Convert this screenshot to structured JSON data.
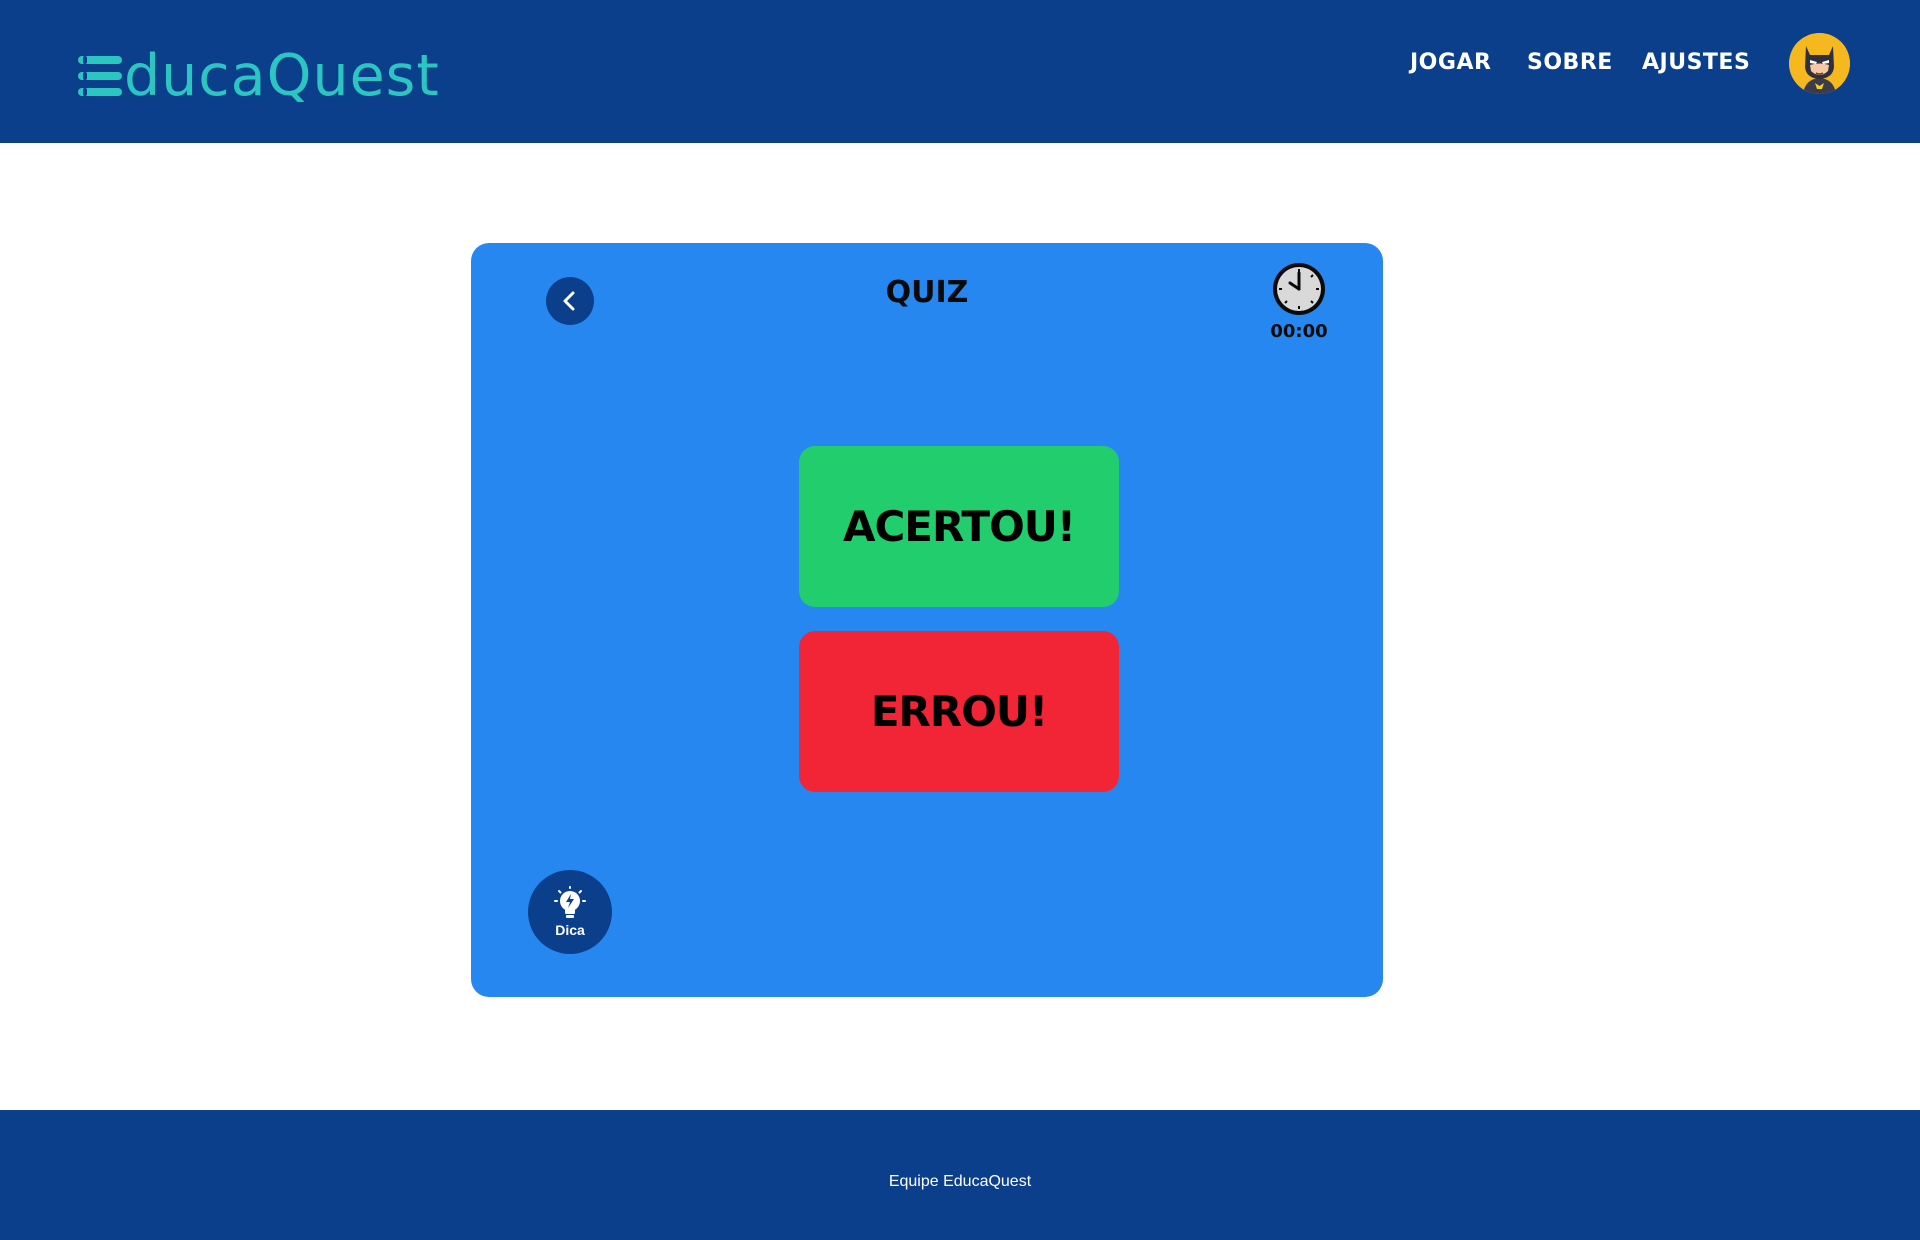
{
  "header": {
    "logo_text": "ducaQuest",
    "logo_icon": "hamburger-e-icon",
    "nav": [
      {
        "label": "JOGAR"
      },
      {
        "label": "SOBRE"
      },
      {
        "label": "AJUSTES"
      }
    ],
    "avatar_icon": "batman-avatar-icon"
  },
  "quiz": {
    "title": "QUIZ",
    "back_icon": "chevron-left-icon",
    "timer_icon": "clock-icon",
    "timer_value": "00:00",
    "answers": {
      "correct_label": "ACERTOU!",
      "wrong_label": "ERROU!"
    },
    "hint": {
      "icon": "lightbulb-icon",
      "label": "Dica"
    }
  },
  "footer": {
    "text": "Equipe EducaQuest"
  },
  "colors": {
    "navy": "#0b3f8b",
    "teal": "#2bc6c1",
    "card_blue": "#2787f0",
    "green": "#21cd6c",
    "red": "#f22536",
    "avatar_yellow": "#f5b81f"
  }
}
